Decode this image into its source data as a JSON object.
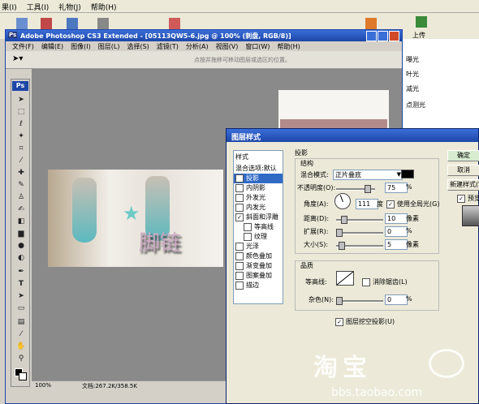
{
  "top_menu": [
    "果(I)",
    "工具(I)",
    "礼物(J)",
    "帮助(H)"
  ],
  "top_toolbar": {
    "upload_label": "上传"
  },
  "right_list": [
    "曝光",
    "叶光",
    "减光",
    "点测光"
  ],
  "ps": {
    "title": "Adobe Photoshop CS3 Extended - [05113QW5-6.jpg @ 100% (刺盘, RGB/8)]",
    "menus": [
      "文件(F)",
      "编辑(E)",
      "图像(I)",
      "图层(L)",
      "选择(S)",
      "滤镜(T)",
      "分析(A)",
      "视图(V)",
      "窗口(W)",
      "帮助(H)"
    ],
    "options_hint": "点按并拖移可移动图层或选区的位置。",
    "tool_logo": "Ps",
    "status_zoom": "100%",
    "status_doc": "文档:267.2K/358.5K",
    "image_text": "脚链"
  },
  "layer_style": {
    "title": "图层样式",
    "styles_header": "样式",
    "blend_default": "混合选项:默认",
    "effects": [
      {
        "label": "投影",
        "checked": true,
        "active": true
      },
      {
        "label": "内阴影",
        "checked": false
      },
      {
        "label": "外发光",
        "checked": false
      },
      {
        "label": "内发光",
        "checked": false
      },
      {
        "label": "斜面和浮雕",
        "checked": true
      },
      {
        "label": "等高线",
        "checked": false,
        "sub": true
      },
      {
        "label": "纹理",
        "checked": false,
        "sub": true
      },
      {
        "label": "光泽",
        "checked": false
      },
      {
        "label": "颜色叠加",
        "checked": false
      },
      {
        "label": "渐变叠加",
        "checked": false
      },
      {
        "label": "图案叠加",
        "checked": false
      },
      {
        "label": "描边",
        "checked": false
      }
    ],
    "section_title": "投影",
    "structure_title": "结构",
    "blend_mode_label": "混合模式:",
    "blend_mode_value": "正片叠底",
    "opacity_label": "不透明度(O):",
    "opacity_value": "75",
    "percent": "%",
    "angle_label": "角度(A):",
    "angle_value": "111",
    "degree": "度",
    "global_light_label": "使用全局光(G)",
    "distance_label": "距离(D):",
    "distance_value": "10",
    "spread_label": "扩展(R):",
    "spread_value": "0",
    "size_label": "大小(S):",
    "size_value": "5",
    "pixel": "像素",
    "quality_title": "品质",
    "contour_label": "等高线:",
    "antialias_label": "消除锯齿(L)",
    "noise_label": "杂色(N):",
    "noise_value": "0",
    "knockout_label": "图层挖空投影(U)",
    "ok_label": "确定",
    "cancel_label": "取消",
    "new_style_label": "新建样式(W)...",
    "preview_label": "预览(V)"
  },
  "watermark": {
    "logo": "淘宝",
    "url": "bbs.taobao.com"
  },
  "colors": {
    "title_blue": "#1d46a8",
    "shadow_swatch": "#000000",
    "canvas_gray": "#8a8a8a"
  }
}
